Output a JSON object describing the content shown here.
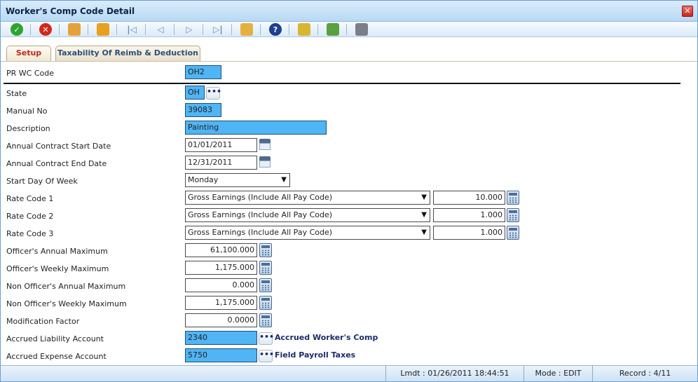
{
  "window": {
    "title": "Worker's Comp Code Detail",
    "close_glyph": "✕"
  },
  "toolbar": {
    "buttons": [
      {
        "name": "save-check-icon",
        "color": "#2fa32f"
      },
      {
        "name": "cancel-x-icon",
        "color": "#d2281c"
      },
      {
        "name": "new-record-icon",
        "color": "#e6a23a"
      },
      {
        "name": "copy-icon",
        "color": "#e8a020"
      },
      {
        "name": "first-record-icon",
        "glyph": "|◁"
      },
      {
        "name": "previous-record-icon",
        "glyph": "◁"
      },
      {
        "name": "next-record-icon",
        "glyph": "▷"
      },
      {
        "name": "last-record-icon",
        "glyph": "▷|"
      },
      {
        "name": "find-icon",
        "color": "#e6b040"
      },
      {
        "name": "help-icon",
        "color": "#1c3f8f",
        "glyph": "?"
      },
      {
        "name": "notes-icon",
        "color": "#d8b630"
      },
      {
        "name": "export-icon",
        "color": "#5aa040"
      },
      {
        "name": "print-icon",
        "color": "#7a7f88"
      }
    ]
  },
  "tabs": [
    {
      "label": "Setup",
      "active": true
    },
    {
      "label": "Taxability Of Reimb & Deduction",
      "active": false
    }
  ],
  "form": {
    "pr_wc_code": {
      "label": "PR WC Code",
      "value": "OH2"
    },
    "state": {
      "label": "State",
      "value": "OH",
      "lookup": "•••"
    },
    "manual_no": {
      "label": "Manual No",
      "value": "39083"
    },
    "description": {
      "label": "Description",
      "value": "Painting"
    },
    "contract_start": {
      "label": "Annual Contract Start Date",
      "value": "01/01/2011"
    },
    "contract_end": {
      "label": "Annual Contract End Date",
      "value": "12/31/2011"
    },
    "start_day": {
      "label": "Start Day Of Week",
      "value": "Monday"
    },
    "rate_code_1": {
      "label": "Rate Code 1",
      "select": "Gross Earnings (Include All Pay Code)",
      "value": "10.000"
    },
    "rate_code_2": {
      "label": "Rate Code 2",
      "select": "Gross Earnings (Include All Pay Code)",
      "value": "1.000"
    },
    "rate_code_3": {
      "label": "Rate Code 3",
      "select": "Gross Earnings (Include All Pay Code)",
      "value": "1.000"
    },
    "officer_annual_max": {
      "label": "Officer's Annual Maximum",
      "value": "61,100.000"
    },
    "officer_weekly_max": {
      "label": "Officer's Weekly Maximum",
      "value": "1,175.000"
    },
    "non_officer_annual_max": {
      "label": "Non Officer's Annual Maximum",
      "value": "0.000"
    },
    "non_officer_weekly_max": {
      "label": "Non Officer's Weekly Maximum",
      "value": "1,175.000"
    },
    "modification_factor": {
      "label": "Modification Factor",
      "value": "0.0000"
    },
    "accrued_liability": {
      "label": "Accrued Liability Account",
      "value": "2340",
      "lookup": "•••",
      "account_name": "Accrued Worker's Comp"
    },
    "accrued_expense": {
      "label": "Accrued Expense Account",
      "value": "5750",
      "lookup": "•••",
      "account_name": "Field Payroll Taxes"
    }
  },
  "dropdown_glyph": "▼",
  "status": {
    "lmdt": "Lmdt : 01/26/2011 18:44:51",
    "mode": "Mode : EDIT",
    "record": "Record : 4/11"
  }
}
